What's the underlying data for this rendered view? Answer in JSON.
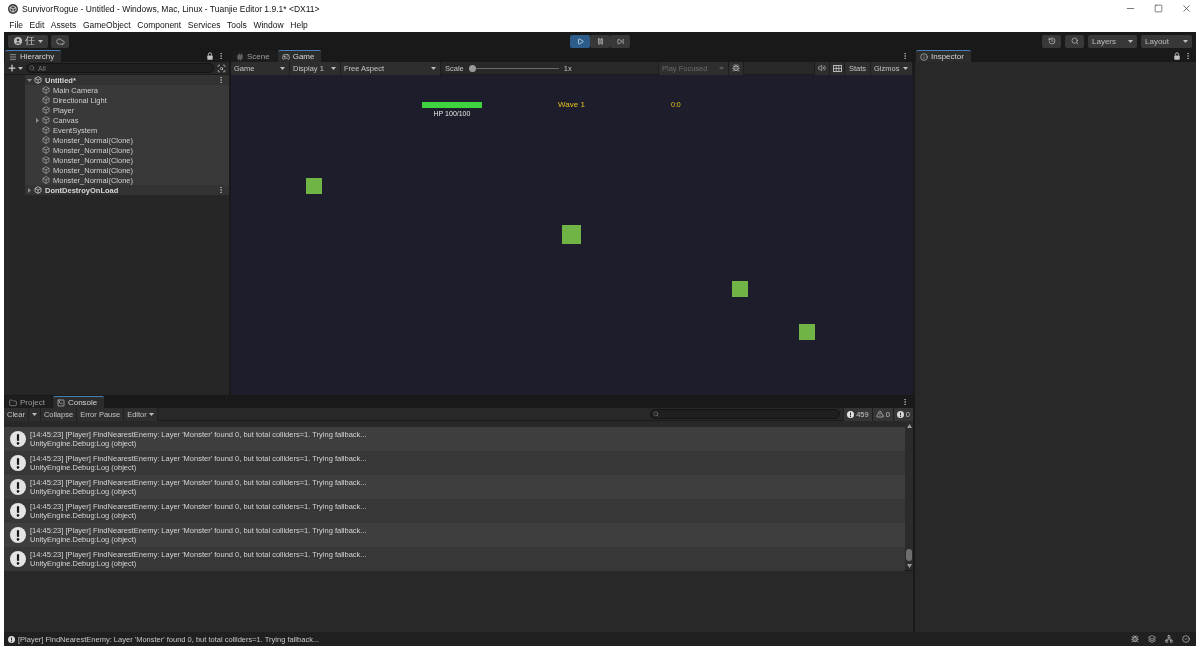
{
  "window": {
    "title": "SurvivorRogue - Untitled - Windows, Mac, Linux - Tuanjie Editor 1.9.1* <DX11>"
  },
  "menu_bar": [
    "File",
    "Edit",
    "Assets",
    "GameObject",
    "Component",
    "Services",
    "Tools",
    "Window",
    "Help"
  ],
  "toolbar": {
    "account": "任",
    "play_controls": [
      {
        "kind": "play",
        "on": true
      },
      {
        "kind": "pause",
        "on": false
      },
      {
        "kind": "step",
        "on": false
      }
    ],
    "dropdowns": [
      "Layers",
      "Layout"
    ]
  },
  "hierarchy": {
    "tab": "Hierarchy",
    "search": {
      "placeholder": "All"
    },
    "scenes": [
      {
        "name": "Untitled*",
        "expanded": true,
        "children": [
          {
            "name": "Main Camera",
            "kind": "leaf",
            "expanded": false
          },
          {
            "name": "Directional Light",
            "kind": "leaf",
            "expanded": false
          },
          {
            "name": "Player",
            "kind": "leaf",
            "expanded": false
          },
          {
            "name": "Canvas",
            "kind": "parent",
            "expanded": false
          },
          {
            "name": "EventSystem",
            "kind": "leaf",
            "expanded": false
          },
          {
            "name": "Monster_Normal(Clone)",
            "kind": "leaf",
            "expanded": false
          },
          {
            "name": "Monster_Normal(Clone)",
            "kind": "leaf",
            "expanded": false
          },
          {
            "name": "Monster_Normal(Clone)",
            "kind": "leaf",
            "expanded": false
          },
          {
            "name": "Monster_Normal(Clone)",
            "kind": "leaf",
            "expanded": false
          },
          {
            "name": "Monster_Normal(Clone)",
            "kind": "leaf",
            "expanded": false
          }
        ]
      },
      {
        "name": "DontDestroyOnLoad",
        "expanded": false
      }
    ]
  },
  "game_view": {
    "tabs": [
      {
        "label": "Scene",
        "kind": "scene",
        "selected": false
      },
      {
        "label": "Game",
        "kind": "game",
        "selected": true
      }
    ],
    "toolbar": {
      "view": "Game",
      "display": "Display 1",
      "aspect": "Free Aspect",
      "scale": {
        "label": "Scale",
        "level": 0,
        "reading": "1x"
      },
      "play_mode": {
        "label": "Play Focused",
        "disabled": true
      },
      "stats": "Stats",
      "gizmos": "Gizmos"
    },
    "hud": {
      "hp_bar": {
        "level": 1,
        "label": "HP 100/100"
      },
      "wave": "Wave 1",
      "timer": "0:0"
    }
  },
  "inspector": {
    "tab": "Inspector"
  },
  "console": {
    "tabs": [
      {
        "label": "Project",
        "kind": "project",
        "selected": false
      },
      {
        "label": "Console",
        "kind": "console",
        "selected": true
      }
    ],
    "toolbar": {
      "clear": "Clear",
      "toggles": [
        {
          "label": "Collapse",
          "on": false
        },
        {
          "label": "Error Pause",
          "on": false
        }
      ],
      "editor": "Editor",
      "counters": [
        {
          "kind": "info",
          "count": "459"
        },
        {
          "kind": "warning",
          "count": "0"
        },
        {
          "kind": "error",
          "count": "0"
        }
      ]
    },
    "entries": [
      {
        "kind": "info",
        "message": "[14:45:23] [Player] FindNearestEnemy: Layer 'Monster' found 0, but total colliders=1. Trying fallback...",
        "trace": "UnityEngine.Debug:Log (object)"
      },
      {
        "kind": "info",
        "message": "[14:45:23] [Player] FindNearestEnemy: Layer 'Monster' found 0, but total colliders=1. Trying fallback...",
        "trace": "UnityEngine.Debug:Log (object)"
      },
      {
        "kind": "info",
        "message": "[14:45:23] [Player] FindNearestEnemy: Layer 'Monster' found 0, but total colliders=1. Trying fallback...",
        "trace": "UnityEngine.Debug:Log (object)"
      },
      {
        "kind": "info",
        "message": "[14:45:23] [Player] FindNearestEnemy: Layer 'Monster' found 0, but total colliders=1. Trying fallback...",
        "trace": "UnityEngine.Debug:Log (object)"
      },
      {
        "kind": "info",
        "message": "[14:45:23] [Player] FindNearestEnemy: Layer 'Monster' found 0, but total colliders=1. Trying fallback...",
        "trace": "UnityEngine.Debug:Log (object)"
      },
      {
        "kind": "info",
        "message": "[14:45:23] [Player] FindNearestEnemy: Layer 'Monster' found 0, but total colliders=1. Trying fallback...",
        "trace": "UnityEngine.Debug:Log (object)"
      }
    ]
  },
  "status_bar": {
    "message": "[Player] FindNearestEnemy: Layer 'Monster' found 0, but total colliders=1. Trying fallback..."
  }
}
